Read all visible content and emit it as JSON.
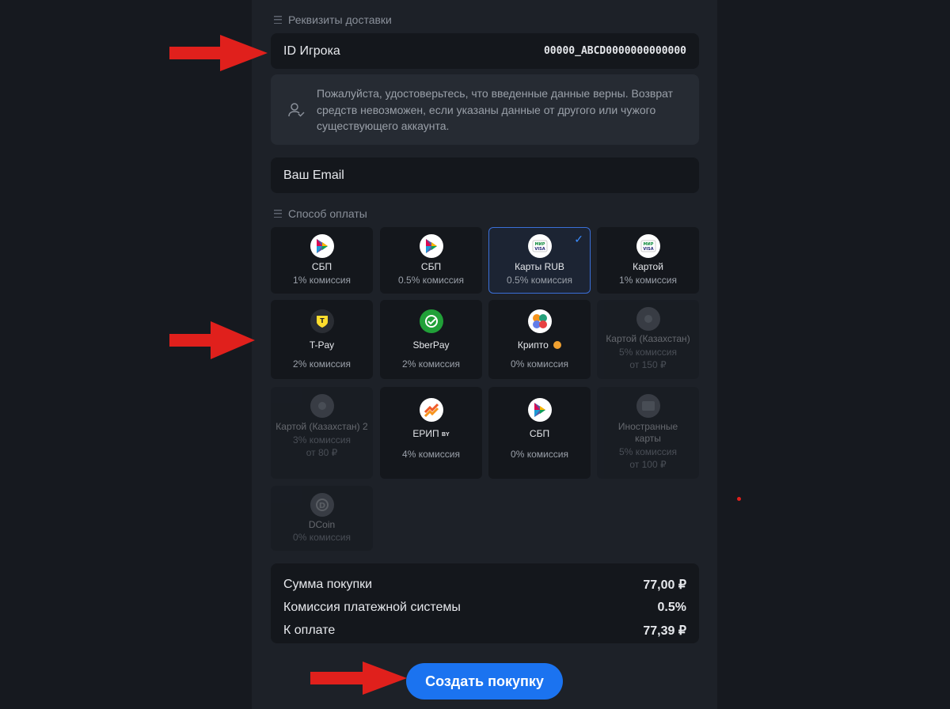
{
  "delivery": {
    "section_title": "Реквизиты доставки",
    "player_id_label": "ID Игрока",
    "player_id_value": "00000_ABCD0000000000000",
    "notice": "Пожалуйста, удостоверьтесь, что введенные данные верны. Возврат средств невозможен, если указаны данные от другого или чужого существующего аккаунта.",
    "email_placeholder": "Ваш Email"
  },
  "payment": {
    "section_title": "Способ оплаты",
    "methods": [
      {
        "name": "СБП",
        "fee": "1% комиссия",
        "min": "",
        "icon": "sbp-icon",
        "selected": false,
        "disabled": false
      },
      {
        "name": "СБП",
        "fee": "0.5% комиссия",
        "min": "",
        "icon": "sbp-icon",
        "selected": false,
        "disabled": false
      },
      {
        "name": "Карты RUB",
        "fee": "0.5% комиссия",
        "min": "",
        "icon": "mir-visa-card-icon",
        "selected": true,
        "disabled": false
      },
      {
        "name": "Картой",
        "fee": "1% комиссия",
        "min": "",
        "icon": "mir-visa-card-icon",
        "selected": false,
        "disabled": false
      },
      {
        "name": "T-Pay",
        "fee": "2% комиссия",
        "min": "",
        "icon": "tpay-icon",
        "selected": false,
        "disabled": false
      },
      {
        "name": "SberPay",
        "fee": "2% комиссия",
        "min": "",
        "icon": "sberpay-icon",
        "selected": false,
        "disabled": false
      },
      {
        "name": "Крипто",
        "fee": "0% комиссия",
        "min": "",
        "icon": "crypto-icon",
        "selected": false,
        "disabled": false
      },
      {
        "name": "Картой (Казахстан)",
        "fee": "5% комиссия",
        "min": "от 150 ₽",
        "icon": "kz-card-icon",
        "selected": false,
        "disabled": true
      },
      {
        "name": "Картой (Казахстан) 2",
        "fee": "3% комиссия",
        "min": "от 80 ₽",
        "icon": "kz-card-icon",
        "selected": false,
        "disabled": true
      },
      {
        "name": "ЕРИП",
        "name_suffix": "BY",
        "fee": "4% комиссия",
        "min": "",
        "icon": "erip-icon",
        "selected": false,
        "disabled": false
      },
      {
        "name": "СБП",
        "fee": "0% комиссия",
        "min": "",
        "icon": "sbp-icon",
        "selected": false,
        "disabled": false
      },
      {
        "name": "Иностранные карты",
        "fee": "5% комиссия",
        "min": "от 100 ₽",
        "icon": "foreign-card-icon",
        "selected": false,
        "disabled": true
      },
      {
        "name": "DCoin",
        "fee": "0% комиссия",
        "min": "",
        "icon": "dcoin-icon",
        "selected": false,
        "disabled": true
      }
    ]
  },
  "summary": {
    "purchase_label": "Сумма покупки",
    "purchase_value": "77,00 ₽",
    "fee_label": "Комиссия платежной системы",
    "fee_value": "0.5%",
    "total_label": "К оплате",
    "total_value": "77,39 ₽"
  },
  "submit_label": "Создать покупку",
  "colors": {
    "accent": "#1b73f0",
    "selected_border": "#3a6fd8",
    "annotation_arrow": "#e0201c"
  }
}
